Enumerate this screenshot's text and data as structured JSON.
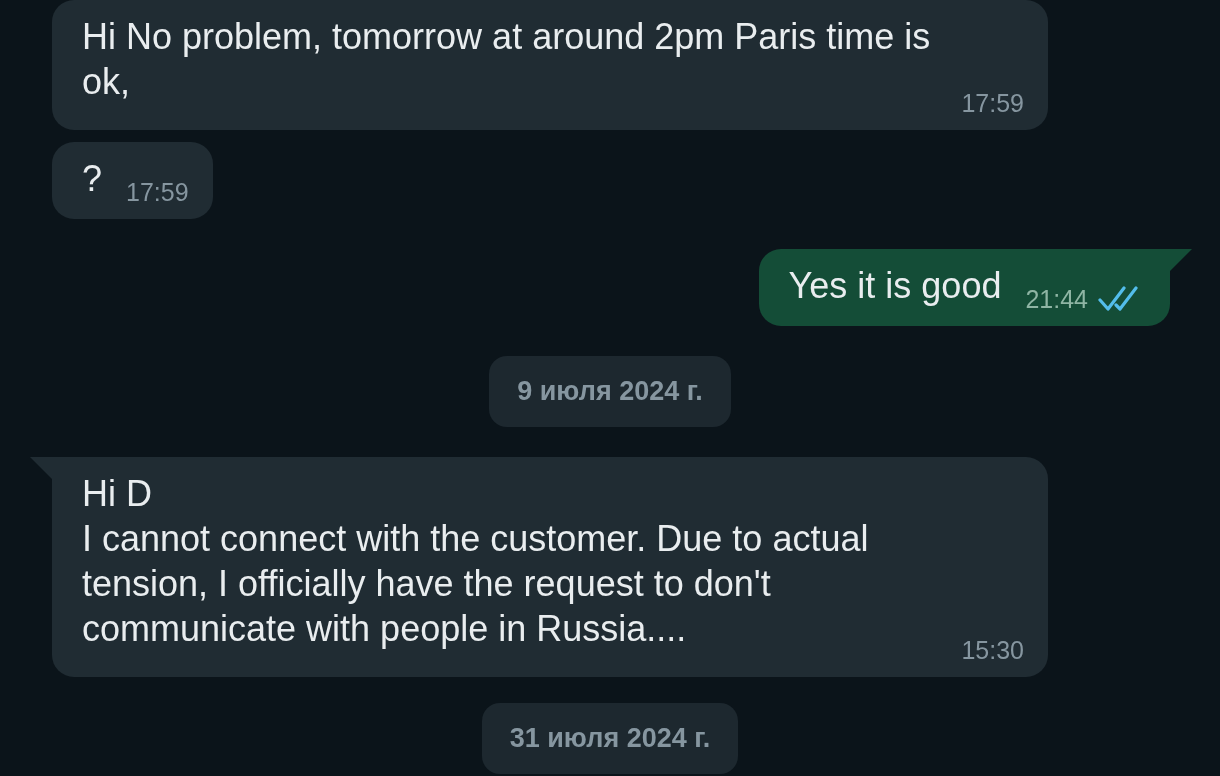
{
  "messages": [
    {
      "kind": "incoming",
      "text": "Hi No problem, tomorrow at around 2pm Paris time is ok,",
      "time": "17:59",
      "tail": false,
      "wide": true
    },
    {
      "kind": "incoming",
      "text": "?",
      "time": "17:59",
      "tail": false,
      "wide": false
    },
    {
      "kind": "outgoing",
      "text": "Yes it is good",
      "time": "21:44",
      "tail": true,
      "wide": false,
      "read": true
    },
    {
      "kind": "date",
      "text": "9 июля 2024 г."
    },
    {
      "kind": "incoming",
      "text": "Hi D\nI cannot connect with the customer. Due to actual tension, I officially have the request to don't communicate with people in Russia....",
      "time": "15:30",
      "tail": true,
      "wide": true
    },
    {
      "kind": "date",
      "text": "31 июля 2024 г."
    }
  ]
}
